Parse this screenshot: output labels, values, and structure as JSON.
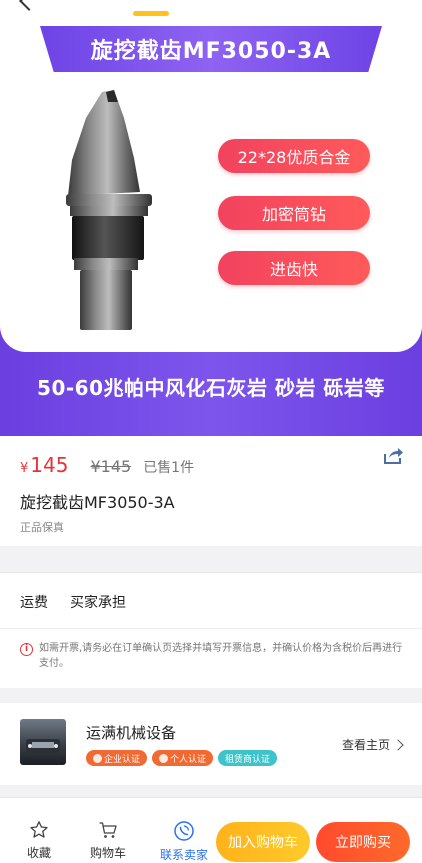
{
  "hero": {
    "title": "旋挖截齿MF3050-3A",
    "features": [
      "22*28优质合金",
      "加密筒钻",
      "进齿快"
    ],
    "bottom_text": "50-60兆帕中风化石灰岩 砂岩 砾岩等"
  },
  "product": {
    "currency": "¥",
    "price": "145",
    "original_price": "¥145",
    "sold": "已售1件",
    "title": "旋挖截齿MF3050-3A",
    "guarantee": "正品保真"
  },
  "shipping": {
    "label": "运费",
    "value": "买家承担",
    "invoice_note": "如需开票,请务必在订单确认页选择并填写开票信息，并确认价格为含税价后再进行支付。"
  },
  "shop": {
    "name": "运满机械设备",
    "badges": [
      "企业认证",
      "个人认证",
      "租赁商认证"
    ],
    "home_link": "查看主页"
  },
  "bottom_bar": {
    "favorite": "收藏",
    "cart": "购物车",
    "contact": "联系卖家",
    "add_to_cart": "加入购物车",
    "buy_now": "立即购买"
  },
  "colors": {
    "accent_purple": "#6d43e6",
    "price_red": "#e8333b",
    "cart_yellow": "#ffb21a",
    "buy_orange": "#ff4a2e",
    "contact_blue": "#2a6ff4"
  }
}
